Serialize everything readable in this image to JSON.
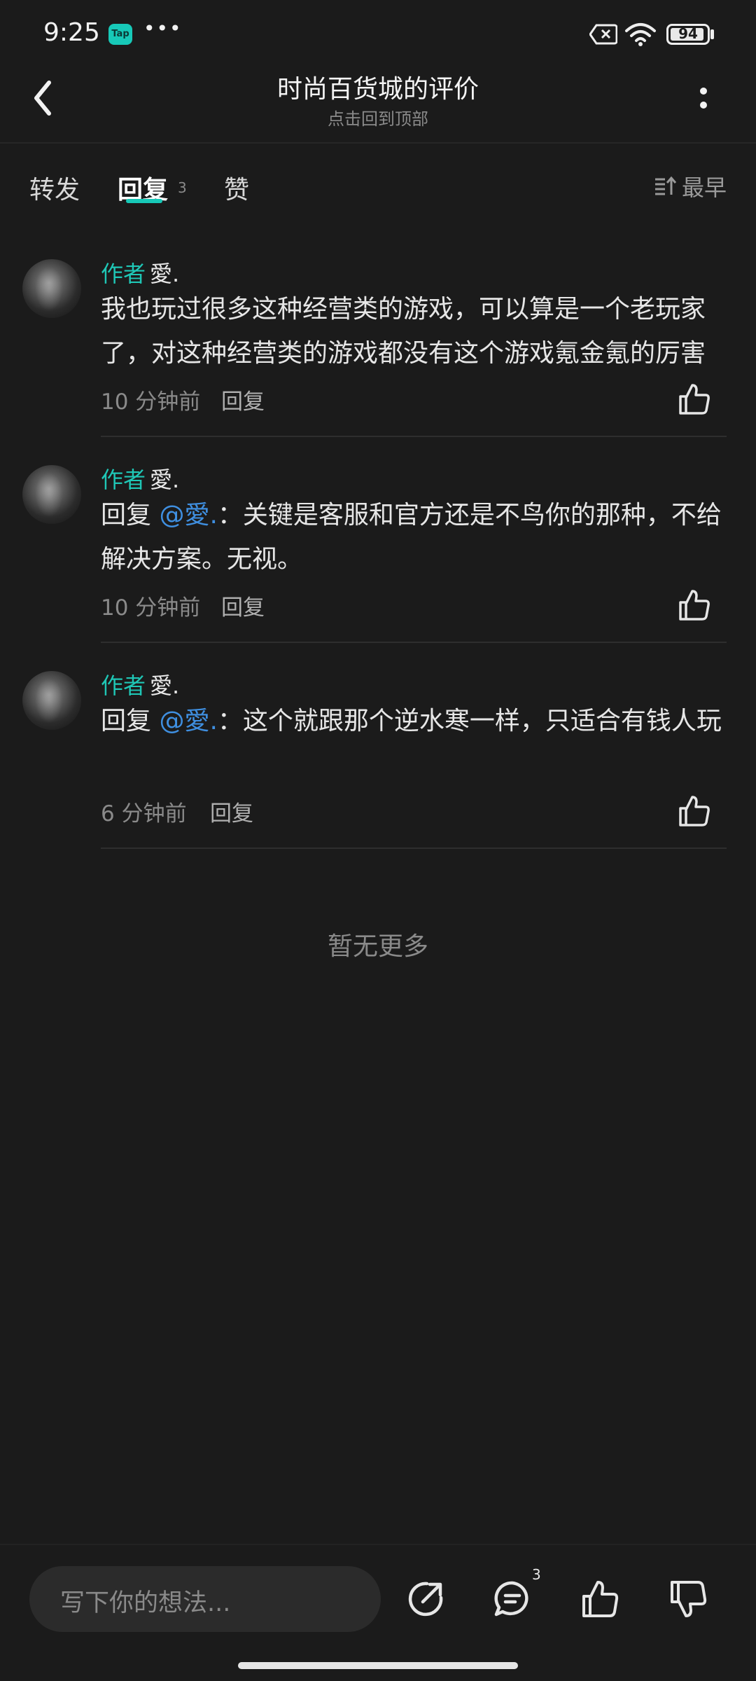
{
  "status_bar": {
    "time": "9:25",
    "app_badge": "Tap",
    "more_dots": "•••",
    "battery": "94",
    "battery_level": 0.94
  },
  "header": {
    "title": "时尚百货城的评价",
    "subtitle": "点击回到顶部"
  },
  "tabs": {
    "forward": "转发",
    "reply": "回复",
    "reply_count": "3",
    "like": "赞",
    "sort_label": "最早"
  },
  "comments": [
    {
      "author_tag": "作者",
      "author_name": "愛.",
      "reply_prefix": "",
      "mention": "",
      "mention_sep": "",
      "text": "我也玩过很多这种经营类的游戏，可以算是一个老玩家了，对这种经营类的游戏都没有这个游戏氪金氪的厉害",
      "time": "10 分钟前",
      "reply_label": "回复"
    },
    {
      "author_tag": "作者",
      "author_name": "愛.",
      "reply_prefix": "回复 ",
      "mention": "@愛.",
      "mention_sep": "：",
      "text": "关键是客服和官方还是不鸟你的那种，不给解决方案。无视。",
      "time": "10 分钟前",
      "reply_label": "回复"
    },
    {
      "author_tag": "作者",
      "author_name": "愛.",
      "reply_prefix": "回复 ",
      "mention": "@愛.",
      "mention_sep": "：",
      "text": "这个就跟那个逆水寒一样，只适合有钱人玩",
      "time": "6 分钟前",
      "reply_label": "回复"
    }
  ],
  "no_more": "暂无更多",
  "bottom_bar": {
    "input_placeholder": "写下你的想法...",
    "comment_count": "3"
  },
  "colors": {
    "accent": "#17c9b8",
    "mention": "#3f8fe0",
    "background": "#1b1b1b"
  },
  "icons": [
    "back-icon",
    "more-vertical-icon",
    "sort-icon",
    "thumb-up-icon",
    "share-icon",
    "comment-icon",
    "thumb-down-icon"
  ]
}
